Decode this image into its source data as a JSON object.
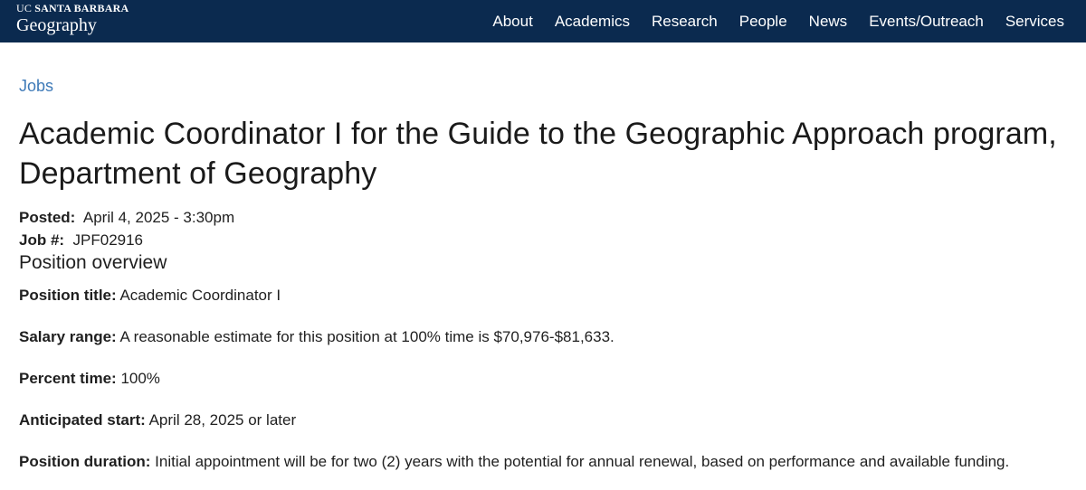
{
  "header": {
    "brand_uc": "UC",
    "brand_sb": "SANTA BARBARA",
    "brand_dept": "Geography",
    "nav": [
      "About",
      "Academics",
      "Research",
      "People",
      "News",
      "Events/Outreach",
      "Services"
    ]
  },
  "breadcrumb": "Jobs",
  "title": "Academic Coordinator I for the Guide to the Geographic Approach program, Department of Geography",
  "meta": {
    "posted_label": "Posted:",
    "posted_value": "April 4, 2025 - 3:30pm",
    "job_label": "Job #:",
    "job_value": "JPF02916"
  },
  "section_title": "Position overview",
  "fields": [
    {
      "label": "Position title:",
      "value": "Academic Coordinator I"
    },
    {
      "label": "Salary range:",
      "value": "A reasonable estimate for this position at 100% time is $70,976-$81,633."
    },
    {
      "label": "Percent time:",
      "value": "100%"
    },
    {
      "label": "Anticipated start:",
      "value": "April 28, 2025 or later"
    },
    {
      "label": "Position duration:",
      "value": "Initial appointment will be for two (2) years with the potential for annual renewal, based on performance and available funding."
    }
  ],
  "colors": {
    "header_bg": "#0b2a4f",
    "link": "#3e7ab8"
  }
}
